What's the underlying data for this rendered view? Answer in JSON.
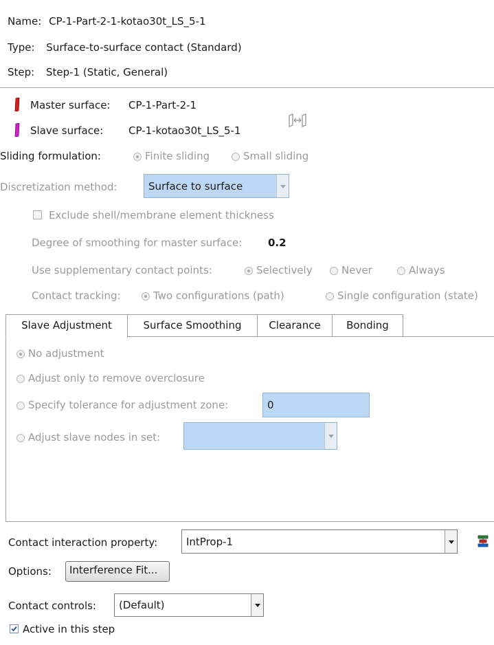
{
  "header": {
    "name_label": "Name:",
    "name_value": "CP-1-Part-2-1-kotao30t_LS_5-1",
    "type_label": "Type:",
    "type_value": "Surface-to-surface contact (Standard)",
    "step_label": "Step:",
    "step_value": "Step-1 (Static, General)"
  },
  "surfaces": {
    "master_label": "Master surface:",
    "master_value": "CP-1-Part-2-1",
    "master_color": "#d42020",
    "slave_label": "Slave surface:",
    "slave_value": "CP-1-kotao30t_LS_5-1",
    "slave_color": "#d020c8",
    "swap_icon": "swap-surfaces-icon"
  },
  "sliding": {
    "label": "Sliding formulation:",
    "options": [
      "Finite sliding",
      "Small sliding"
    ],
    "selected": "Finite sliding"
  },
  "discretization": {
    "label": "Discretization method:",
    "value": "Surface to surface"
  },
  "exclude_shell": {
    "label": "Exclude shell/membrane element thickness",
    "checked": false
  },
  "smoothing": {
    "label": "Degree of smoothing for master surface:",
    "value": "0.2"
  },
  "supplementary": {
    "label": "Use supplementary contact points:",
    "options": [
      "Selectively",
      "Never",
      "Always"
    ],
    "selected": "Selectively"
  },
  "tracking": {
    "label": "Contact tracking:",
    "options": [
      "Two configurations (path)",
      "Single configuration (state)"
    ],
    "selected": "Two configurations (path)"
  },
  "tabs": [
    "Slave Adjustment",
    "Surface Smoothing",
    "Clearance",
    "Bonding"
  ],
  "slave_adjustment": {
    "options": [
      "No adjustment",
      "Adjust only to remove overclosure",
      "Specify tolerance for adjustment zone:",
      "Adjust slave nodes in set:"
    ],
    "selected": "No adjustment",
    "tolerance_value": "0",
    "node_set_value": ""
  },
  "footer": {
    "property_label": "Contact interaction property:",
    "property_value": "IntProp-1",
    "property_icon": "create-property-icon",
    "options_label": "Options:",
    "options_button": "Interference Fit...",
    "controls_label": "Contact controls:",
    "controls_value": "(Default)",
    "active_label": "Active in this step",
    "active_checked": true
  }
}
